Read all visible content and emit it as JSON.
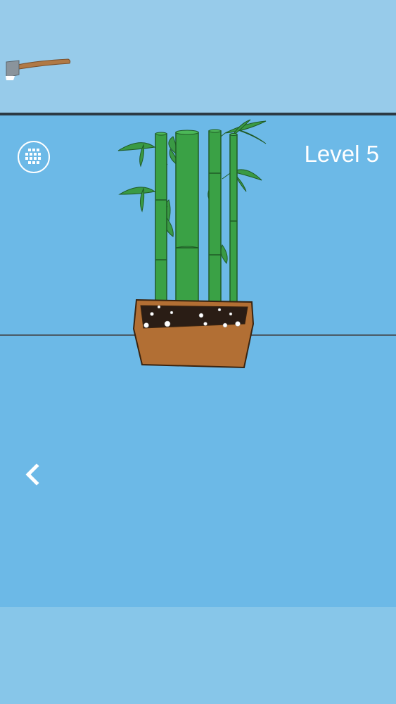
{
  "inventory": {
    "items": [
      {
        "name": "axe",
        "icon": "axe-icon",
        "selected": false
      }
    ]
  },
  "hud": {
    "level_label": "Level 5",
    "menu_icon": "grid-menu-icon",
    "back_icon": "chevron-left-icon"
  },
  "scene": {
    "object": "potted-bamboo",
    "stalk_count": 4
  },
  "colors": {
    "inventory_bg": "#97cbea",
    "scene_bg": "#6cb9e7",
    "bottom_bg": "#87c6e9",
    "bamboo": "#3aa145",
    "pot": "#b26f34",
    "text": "#ffffff"
  }
}
